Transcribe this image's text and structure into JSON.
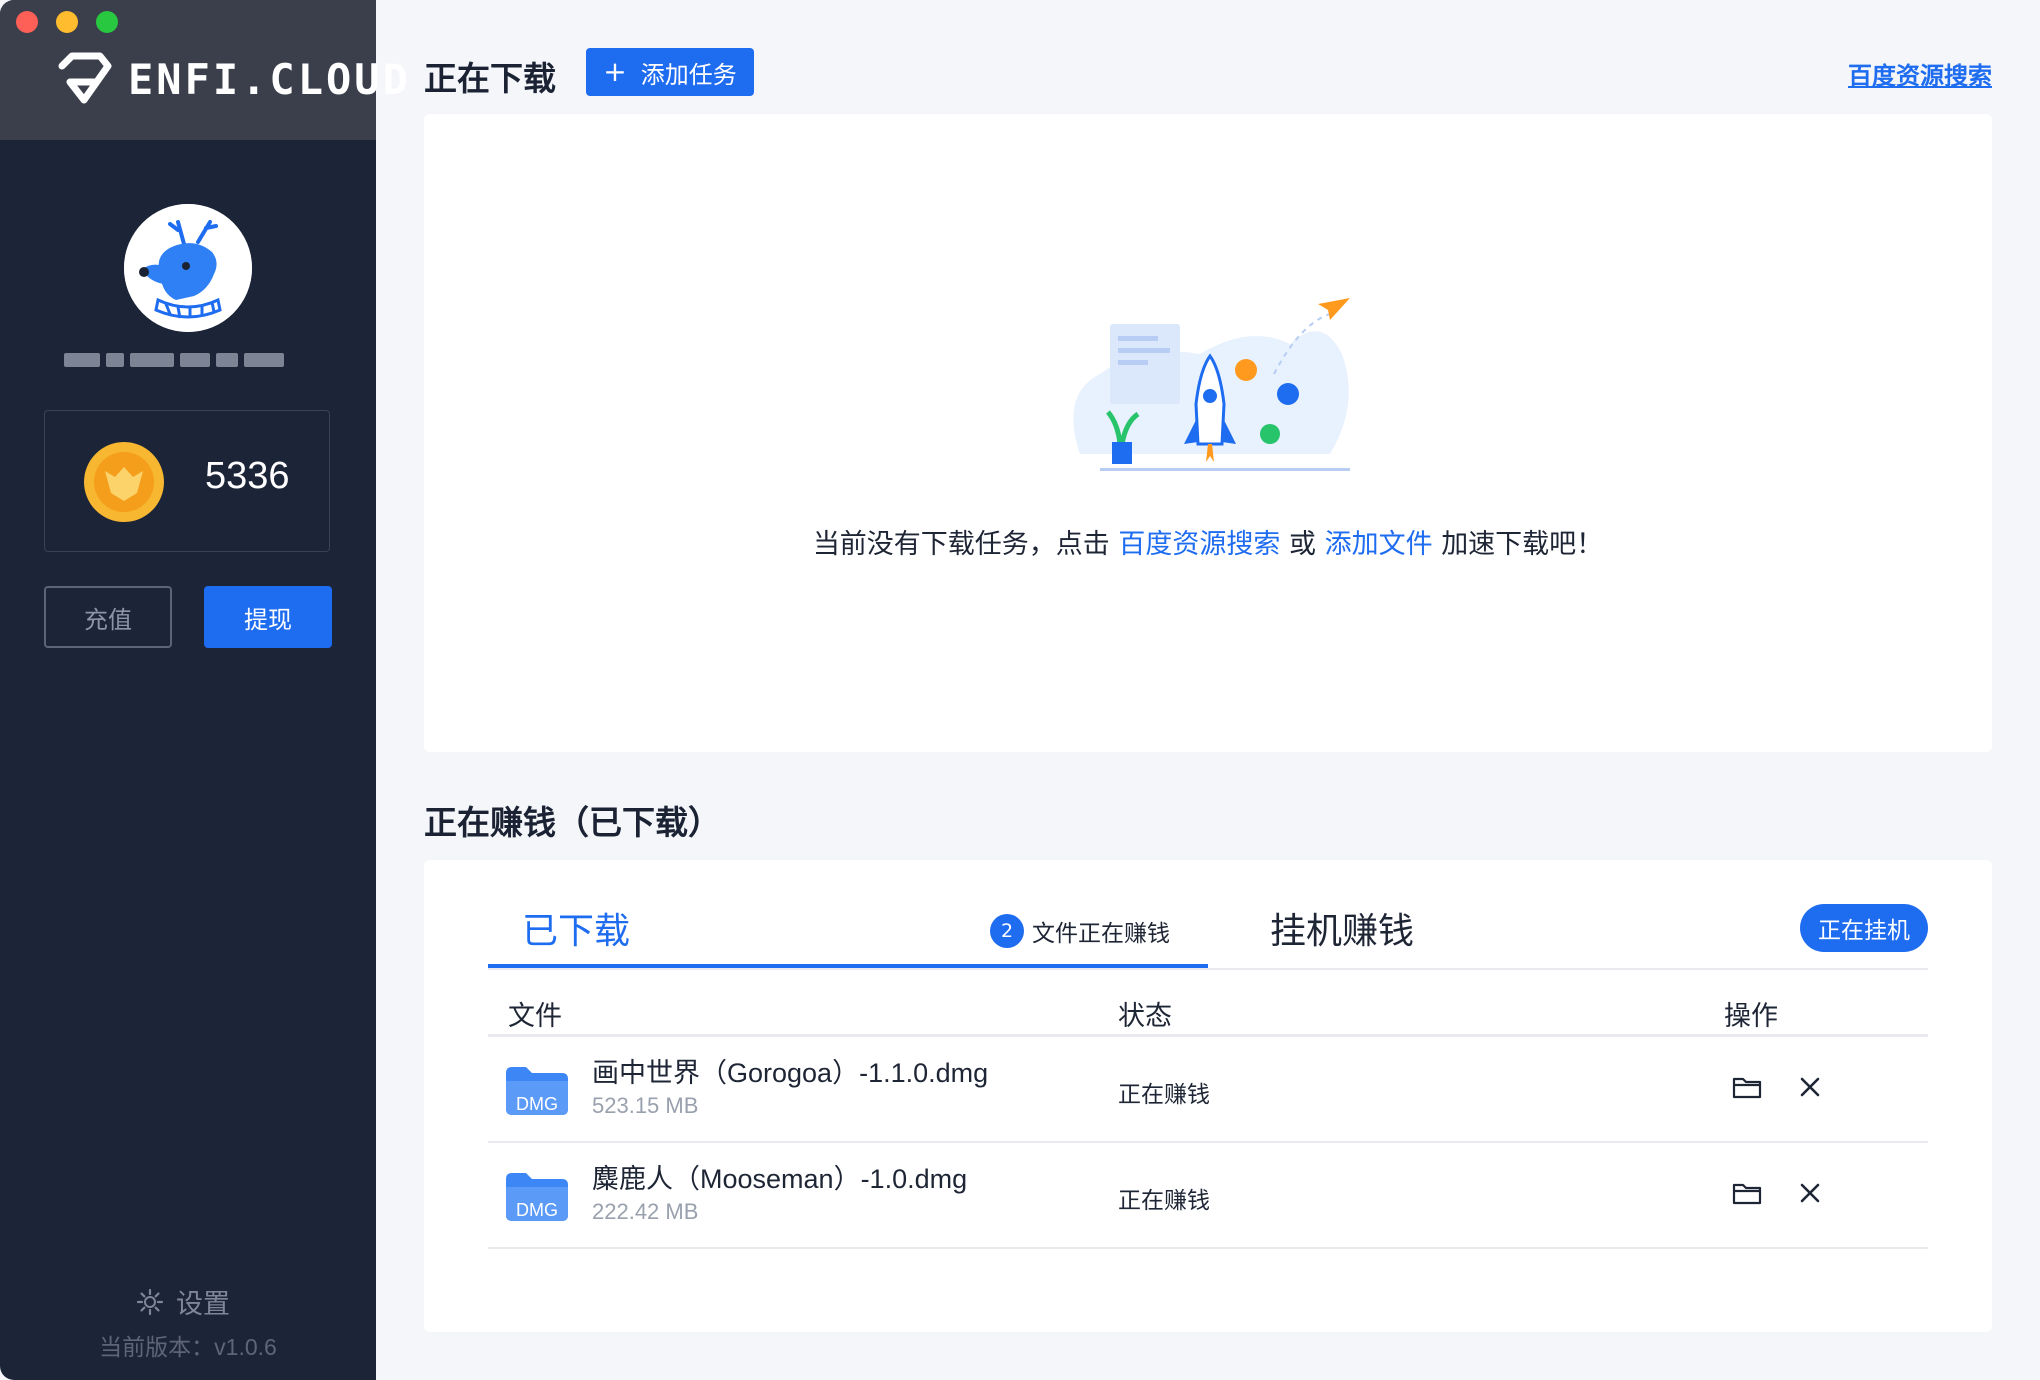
{
  "sidebar": {
    "logo_text": "ENFI.CLOUD",
    "balance": "5336",
    "recharge_label": "充值",
    "withdraw_label": "提现",
    "settings_label": "设置",
    "version": "当前版本：v1.0.6"
  },
  "downloading": {
    "title": "正在下载",
    "add_task_label": "添加任务",
    "baidu_search_link": "百度资源搜索",
    "empty": {
      "prefix": "当前没有下载任务，点击",
      "link_search": "百度资源搜索",
      "or": "或",
      "link_add_file": "添加文件",
      "suffix": "加速下载吧！"
    }
  },
  "earning": {
    "title": "正在赚钱（已下载）",
    "tabs": {
      "downloaded": "已下载",
      "count": "2",
      "count_label": "文件正在赚钱",
      "hang": "挂机赚钱",
      "hanging_button": "正在挂机"
    },
    "columns": {
      "file": "文件",
      "status": "状态",
      "operation": "操作"
    },
    "files": [
      {
        "name": "画中世界（Gorogoa）-1.1.0.dmg",
        "size": "523.15 MB",
        "status": "正在赚钱",
        "icon_label": "DMG"
      },
      {
        "name": "麋鹿人（Mooseman）-1.0.dmg",
        "size": "222.42 MB",
        "status": "正在赚钱",
        "icon_label": "DMG"
      }
    ]
  },
  "colors": {
    "accent": "#1e6cf0",
    "sidebar_bg": "#1c2438",
    "coin": "#f7b731"
  }
}
